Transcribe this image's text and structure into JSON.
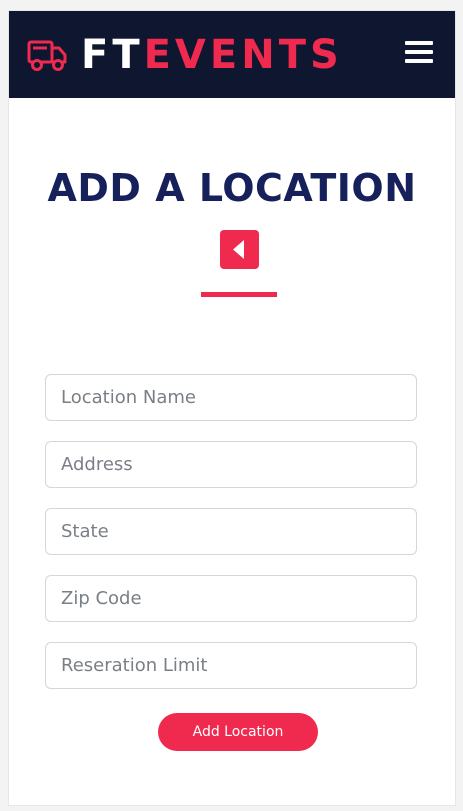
{
  "brand": {
    "part1": "FT",
    "part2": "EVENTS",
    "icon": "food-truck-icon",
    "primary_color": "#f0294f",
    "nav_color": "#0f1630"
  },
  "nav": {
    "menu_icon": "hamburger-menu-icon"
  },
  "page": {
    "title": "ADD A LOCATION",
    "back_icon": "caret-left-icon",
    "title_color": "#16205a"
  },
  "form": {
    "fields": [
      {
        "placeholder": "Location Name",
        "value": ""
      },
      {
        "placeholder": "Address",
        "value": ""
      },
      {
        "placeholder": "State",
        "value": ""
      },
      {
        "placeholder": "Zip Code",
        "value": ""
      },
      {
        "placeholder": "Reseration Limit",
        "value": ""
      }
    ],
    "submit_label": "Add Location"
  }
}
